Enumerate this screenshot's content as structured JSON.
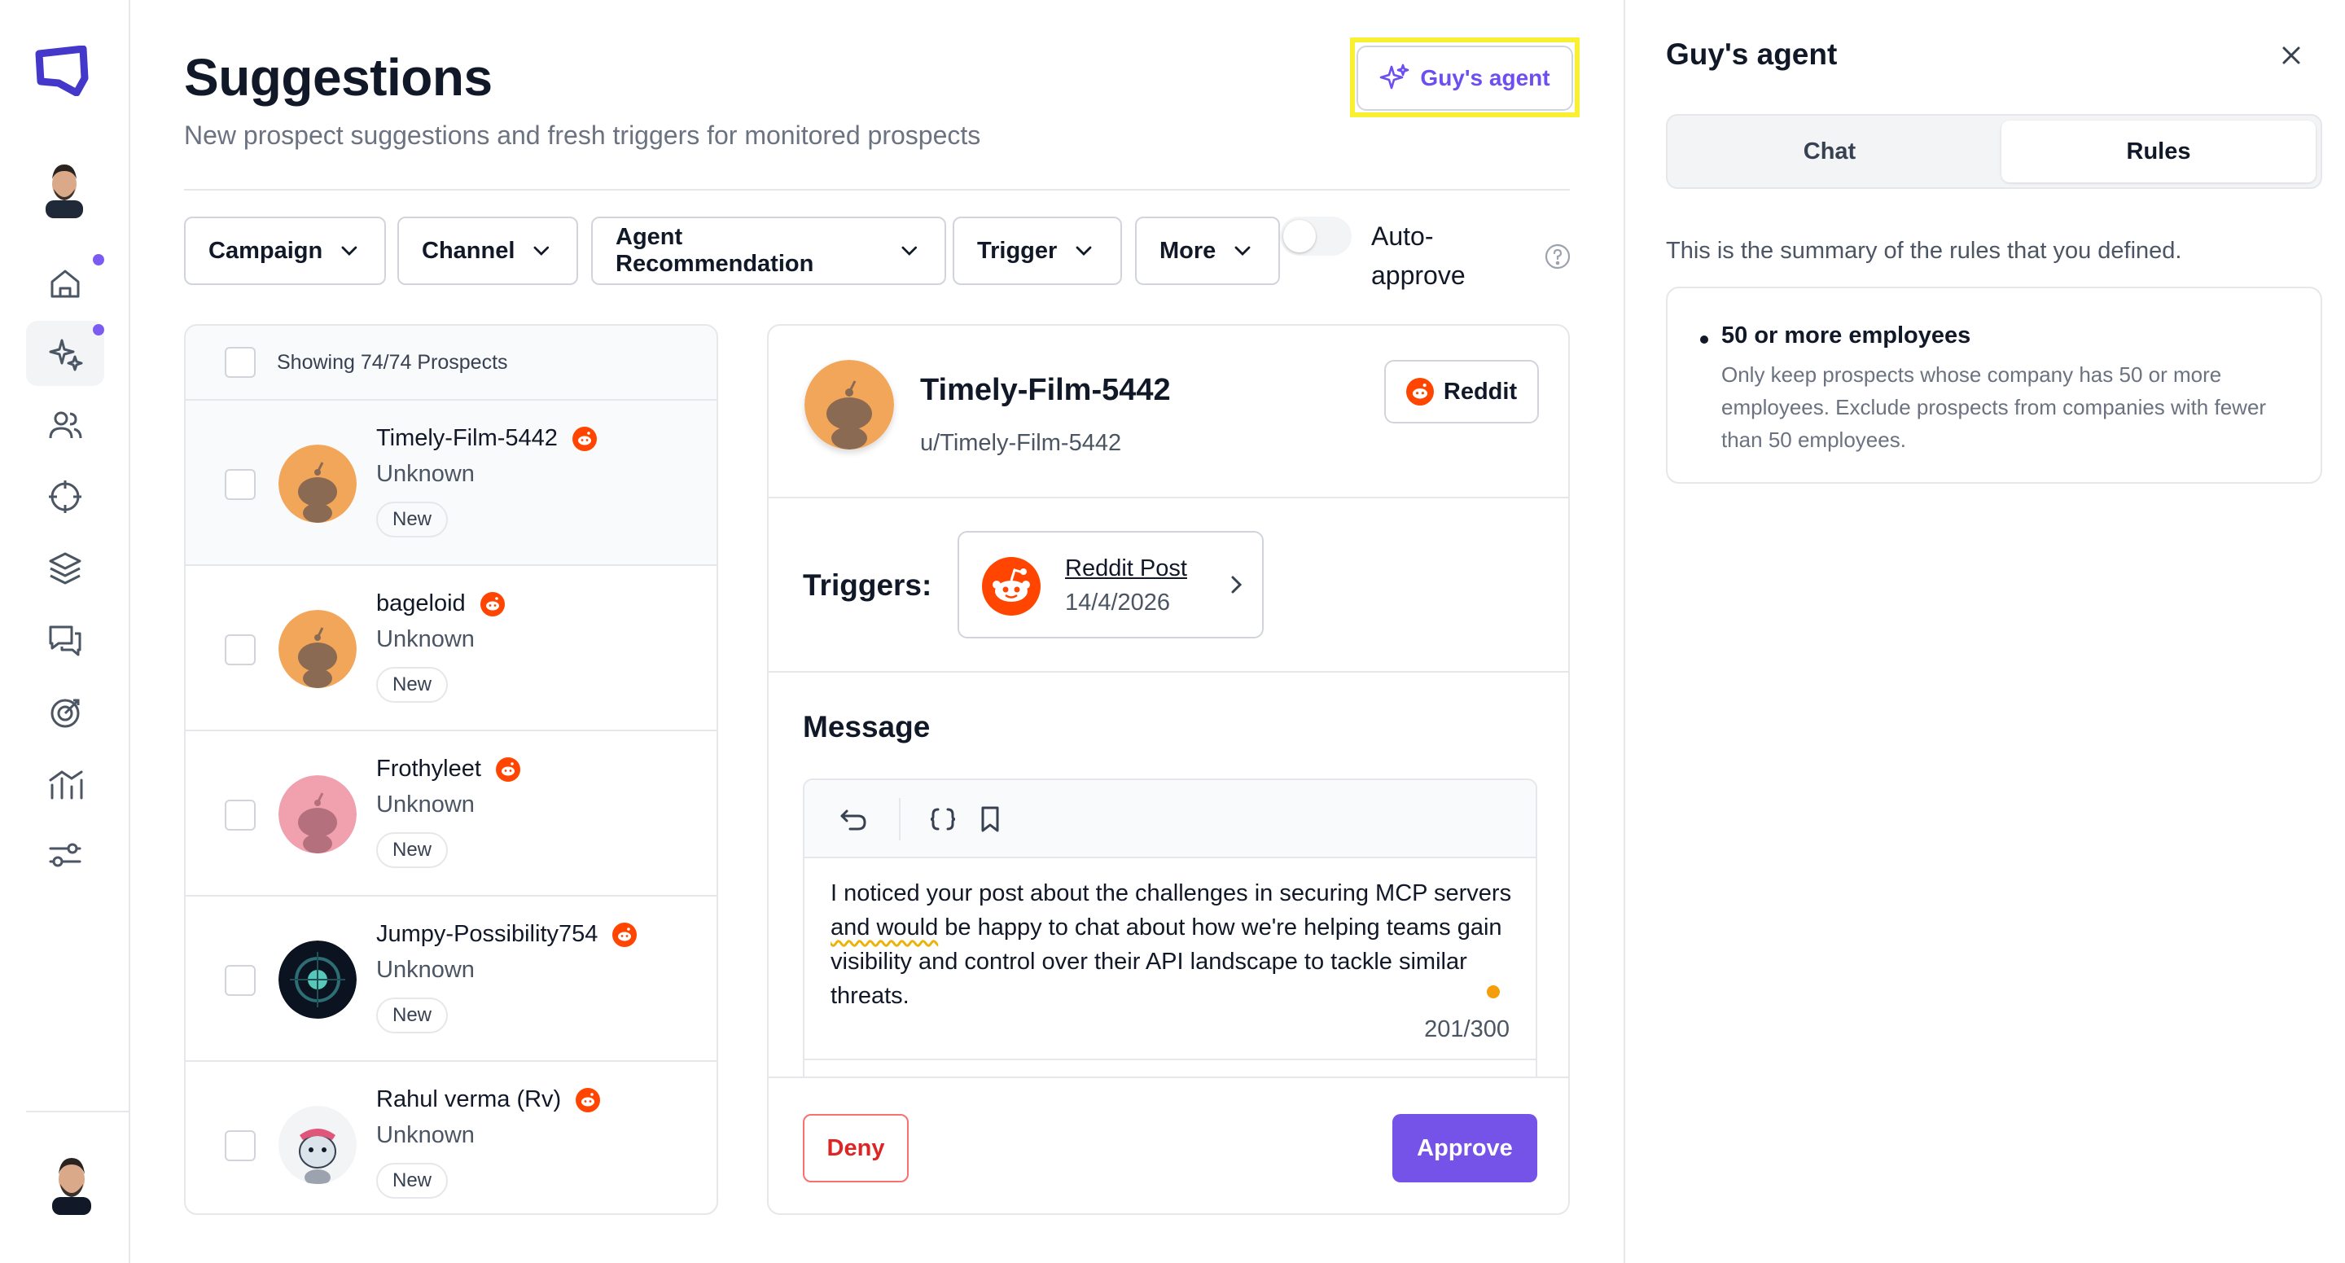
{
  "sidebar": {
    "nav_icons": [
      "home-icon",
      "sparkles-icon",
      "users-icon",
      "crosshair-icon",
      "layers-icon",
      "messages-icon",
      "target-icon",
      "analytics-icon",
      "settings-sliders-icon"
    ],
    "active_item": "sparkles-icon",
    "badge_color": "#7c5cf0"
  },
  "header": {
    "title": "Suggestions",
    "subtitle": "New prospect suggestions and fresh triggers for monitored prospects",
    "agent_button_label": "Guy's agent"
  },
  "filters": {
    "campaign": "Campaign",
    "channel": "Channel",
    "agent_recommendation": "Agent Recommendation",
    "trigger": "Trigger",
    "more": "More",
    "auto_approve_label": "Auto-approve",
    "auto_approve_on": false
  },
  "list": {
    "showing": "Showing 74/74 Prospects",
    "prospects": [
      {
        "name": "Timely-Film-5442",
        "status": "Unknown",
        "badge": "New",
        "avatar": "reddit-orange-avatar"
      },
      {
        "name": "bageloid",
        "status": "Unknown",
        "badge": "New",
        "avatar": "reddit-orange-avatar"
      },
      {
        "name": "Frothyleet",
        "status": "Unknown",
        "badge": "New",
        "avatar": "reddit-pink-avatar"
      },
      {
        "name": "Jumpy-Possibility754",
        "status": "Unknown",
        "badge": "New",
        "avatar": "dark-abstract-avatar"
      },
      {
        "name": "Rahul verma (Rv)",
        "status": "Unknown",
        "badge": "New",
        "avatar": "reddit-custom-avatar"
      }
    ]
  },
  "detail": {
    "name": "Timely-Film-5442",
    "handle": "u/Timely-Film-5442",
    "platform": "Reddit",
    "triggers_label": "Triggers:",
    "trigger": {
      "title": "Reddit Post",
      "date": "14/4/2026"
    },
    "message_label": "Message",
    "message_before": "I noticed your post about the challenges in securing MCP servers ",
    "message_flagged": "and would",
    "message_after": " be happy to chat about how we're helping teams gain visibility and control over their API landscape to tackle similar threats.",
    "char_count": "201/300",
    "deny_label": "Deny",
    "approve_label": "Approve"
  },
  "panel": {
    "title": "Guy's agent",
    "tabs": {
      "chat": "Chat",
      "rules": "Rules"
    },
    "active_tab": "Rules",
    "description": "This is the summary of the rules that you defined.",
    "rules": [
      {
        "title": "50 or more employees",
        "description": "Only keep prospects whose company has 50 or more employees. Exclude prospects from companies with fewer than 50 employees."
      }
    ]
  },
  "colors": {
    "accent": "#7653e8",
    "reddit": "#ff4500",
    "deny": "#dc2626",
    "highlight": "#faf032"
  }
}
